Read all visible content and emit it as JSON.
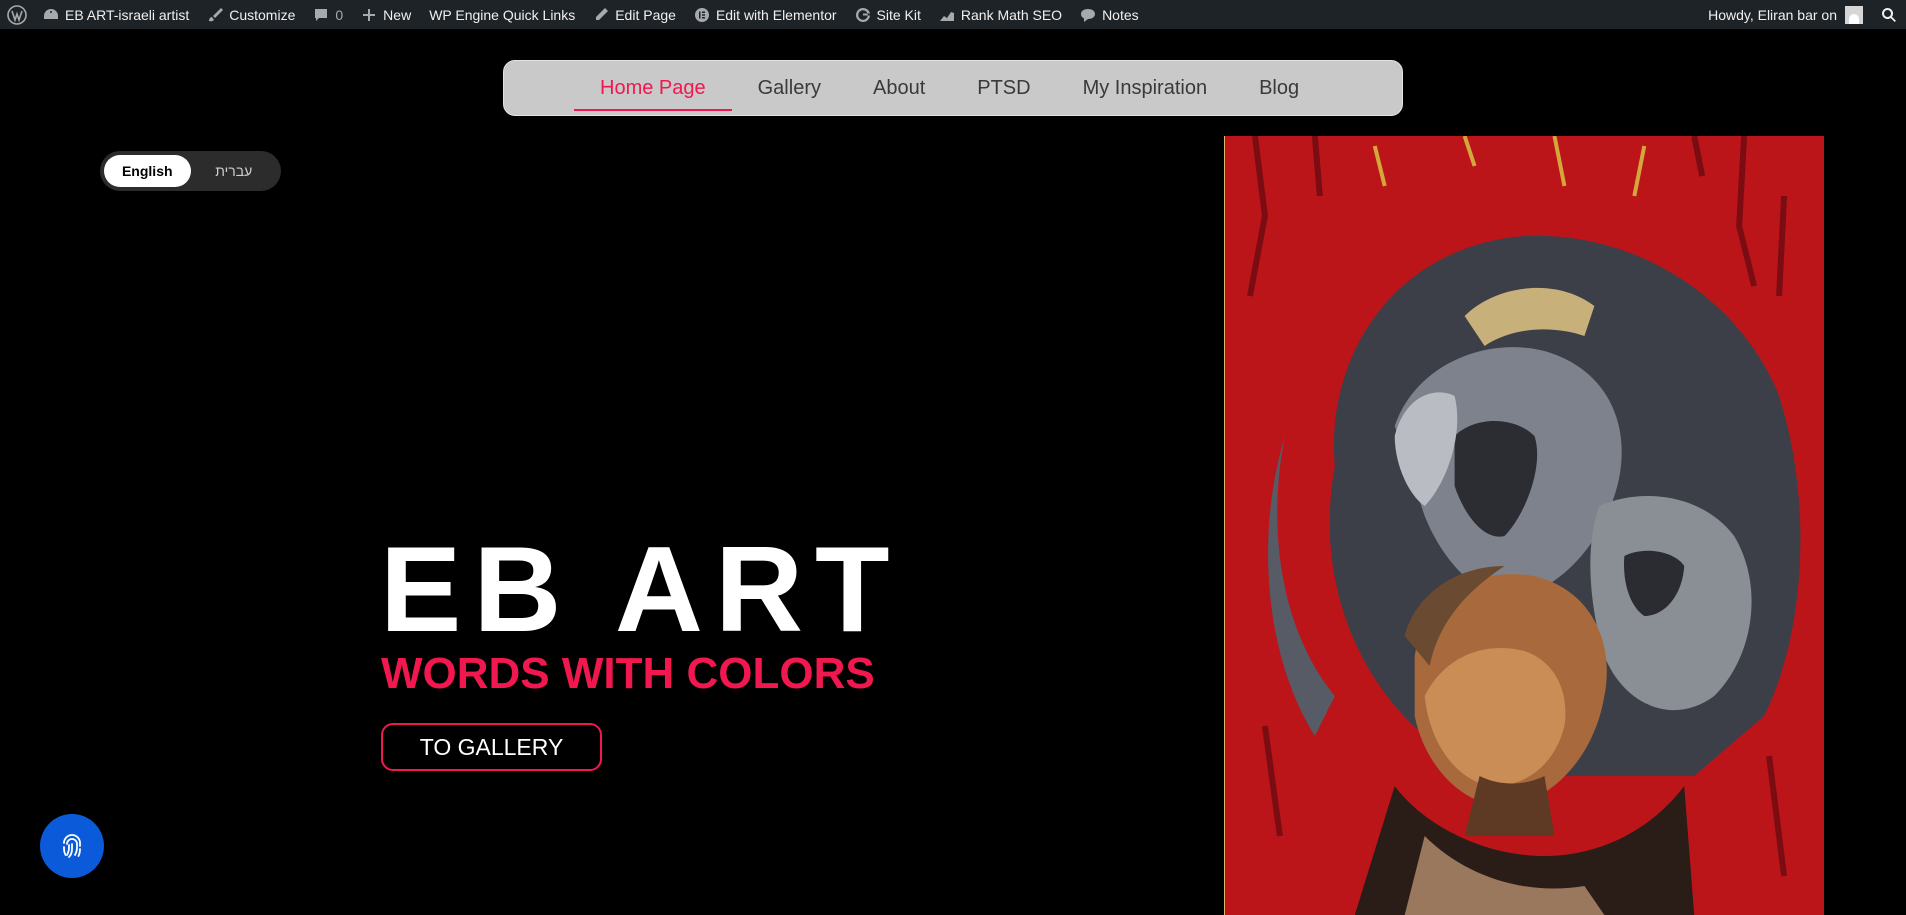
{
  "adminbar": {
    "site_name": "EB ART-israeli artist",
    "customize": "Customize",
    "comments_count": "0",
    "new": "New",
    "wp_engine": "WP Engine Quick Links",
    "edit_page": "Edit Page",
    "edit_elementor": "Edit with Elementor",
    "site_kit": "Site Kit",
    "rank_math": "Rank Math SEO",
    "notes": "Notes",
    "howdy": "Howdy, Eliran bar on"
  },
  "nav": {
    "items": [
      {
        "label": "Home Page"
      },
      {
        "label": "Gallery"
      },
      {
        "label": "About"
      },
      {
        "label": "PTSD"
      },
      {
        "label": "My Inspiration"
      },
      {
        "label": "Blog"
      }
    ]
  },
  "language": {
    "english": "English",
    "hebrew": "עברית"
  },
  "hero": {
    "title": "EB ART",
    "subtitle": "WORDS WITH COLORS",
    "cta": "TO GALLERY"
  },
  "colors": {
    "accent": "#f0184f",
    "adminbar": "#1d2327",
    "nav_bg": "#c9c9c9",
    "a11y": "#0b5ad9"
  }
}
